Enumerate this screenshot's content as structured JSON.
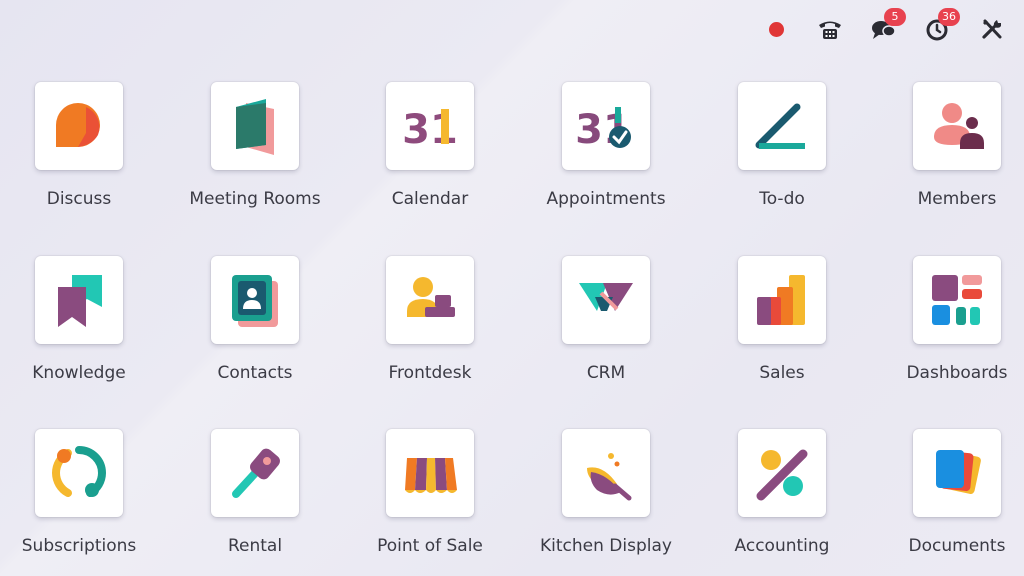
{
  "systray": {
    "messages_count": "5",
    "activities_count": "36",
    "colors": {
      "record": "#e03636",
      "badge": "#e8424f"
    }
  },
  "apps": [
    {
      "label": "Discuss",
      "icon": "discuss-icon"
    },
    {
      "label": "Meeting Rooms",
      "icon": "meeting-rooms-icon"
    },
    {
      "label": "Calendar",
      "icon": "calendar-icon",
      "icon_text": "31"
    },
    {
      "label": "Appointments",
      "icon": "appointments-icon",
      "icon_text": "31"
    },
    {
      "label": "To-do",
      "icon": "todo-icon"
    },
    {
      "label": "Members",
      "icon": "members-icon"
    },
    {
      "label": "Knowledge",
      "icon": "knowledge-icon"
    },
    {
      "label": "Contacts",
      "icon": "contacts-icon"
    },
    {
      "label": "Frontdesk",
      "icon": "frontdesk-icon"
    },
    {
      "label": "CRM",
      "icon": "crm-icon"
    },
    {
      "label": "Sales",
      "icon": "sales-icon"
    },
    {
      "label": "Dashboards",
      "icon": "dashboards-icon"
    },
    {
      "label": "Subscriptions",
      "icon": "subscriptions-icon"
    },
    {
      "label": "Rental",
      "icon": "rental-icon"
    },
    {
      "label": "Point of Sale",
      "icon": "point-of-sale-icon"
    },
    {
      "label": "Kitchen Display",
      "icon": "kitchen-display-icon"
    },
    {
      "label": "Accounting",
      "icon": "accounting-icon"
    },
    {
      "label": "Documents",
      "icon": "documents-icon"
    }
  ]
}
